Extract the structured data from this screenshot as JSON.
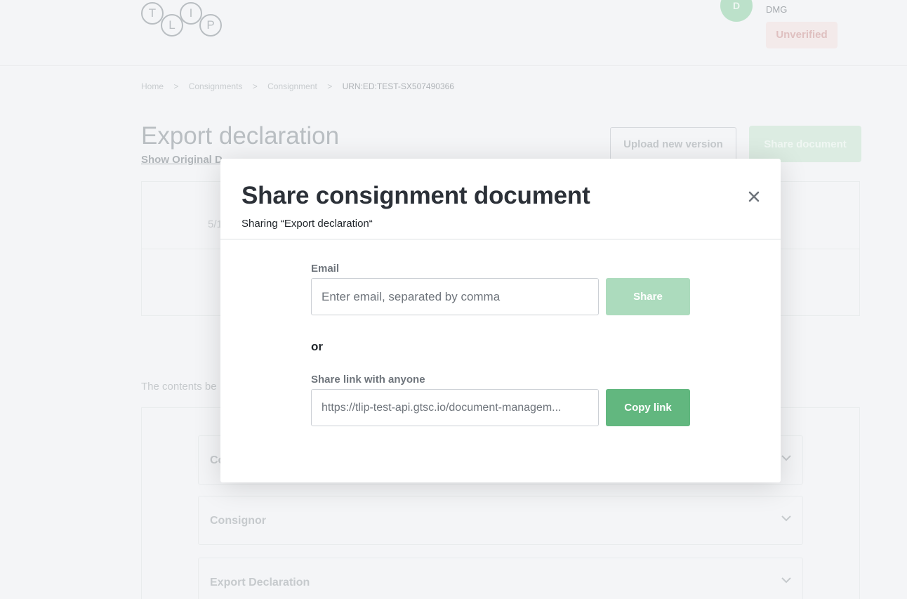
{
  "header": {
    "logo_letters": [
      "T",
      "L",
      "I",
      "P"
    ],
    "avatar_initial": "D",
    "user_org": "DMG",
    "status_badge": "Unverified"
  },
  "breadcrumb": {
    "items": [
      "Home",
      "Consignments",
      "Consignment",
      "URN:ED:TEST-SX507490366"
    ],
    "separator": ">"
  },
  "page": {
    "title": "Export declaration",
    "link_show_original": "Show Original D",
    "upload_label": "Upload new version",
    "share_label": "Share document",
    "version_fragment": "5/1",
    "contents_note": "The contents be",
    "sections": [
      "Co",
      "Consignor",
      "Export Declaration"
    ]
  },
  "modal": {
    "title": "Share consignment document",
    "subtitle": "Sharing “Export declaration“",
    "close_icon": "close-icon",
    "email_label": "Email",
    "email_placeholder": "Enter email, separated by comma",
    "share_button": "Share",
    "or_text": "or",
    "link_label": "Share link with anyone",
    "link_value": "https://tlip-test-api.gtsc.io/document-managem...",
    "copy_button": "Copy link"
  },
  "colors": {
    "accent_green": "#62b77f",
    "accent_green_disabled": "#acdbbd",
    "text_dark": "#2c3138"
  }
}
